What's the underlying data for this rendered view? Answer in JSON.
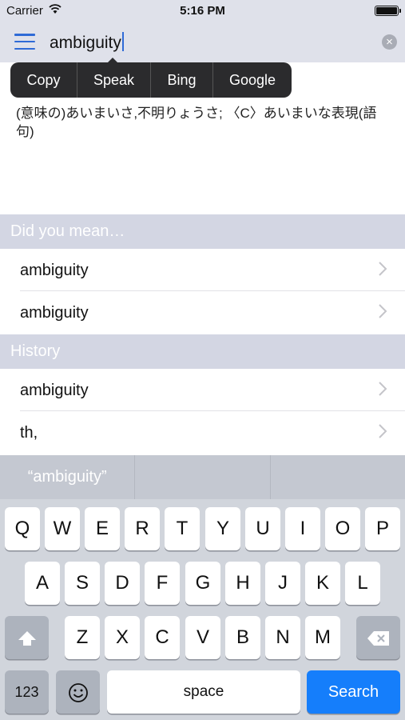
{
  "status": {
    "carrier": "Carrier",
    "time": "5:16 PM"
  },
  "search": {
    "query": "ambiguity",
    "clear_glyph": "×"
  },
  "edit_menu": [
    "Copy",
    "Speak",
    "Bing",
    "Google"
  ],
  "definition": "(意味の)あいまいさ,不明りょうさ; 〈C〉あいまいな表現(語句)",
  "did_you_mean": {
    "title": "Did you mean…",
    "items": [
      "ambiguity",
      "ambiguity"
    ]
  },
  "history": {
    "title": "History",
    "items": [
      "ambiguity",
      "th,"
    ]
  },
  "suggestions": [
    "“ambiguity”",
    "",
    ""
  ],
  "keyboard": {
    "row1": [
      "Q",
      "W",
      "E",
      "R",
      "T",
      "Y",
      "U",
      "I",
      "O",
      "P"
    ],
    "row2": [
      "A",
      "S",
      "D",
      "F",
      "G",
      "H",
      "J",
      "K",
      "L"
    ],
    "row3": [
      "Z",
      "X",
      "C",
      "V",
      "B",
      "N",
      "M"
    ],
    "numbers": "123",
    "space": "space",
    "search": "Search"
  },
  "colors": {
    "accent": "#2f6ad6",
    "search_key": "#157efb",
    "header_bg": "#dfe1ea",
    "section_bg": "#d3d6e3"
  },
  "icons": {
    "menu": "hamburger-icon",
    "wifi": "wifi-icon",
    "battery": "battery-icon",
    "clear": "clear-icon",
    "chevron": "chevron-right-icon",
    "shift": "shift-icon",
    "delete": "backspace-icon",
    "emoji": "emoji-icon"
  }
}
